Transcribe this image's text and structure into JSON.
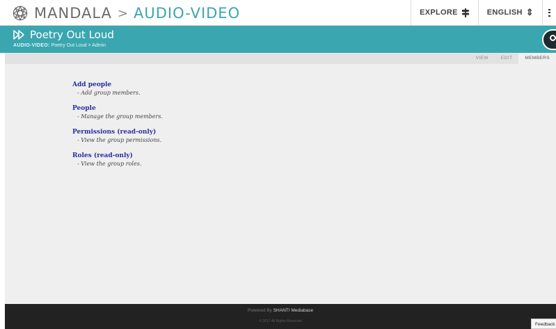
{
  "header": {
    "brand": "MANDALA",
    "separator": ">",
    "section": "AUDIO-VIDEO",
    "explore_label": "EXPLORE",
    "language_label": "ENGLISH",
    "language_caret": "↕",
    "logo_icon": "mandala-logo-icon",
    "explore_icon": "signpost-icon",
    "menu_icon": "hamburger-menu-icon"
  },
  "title_bar": {
    "title": "Poetry Out Loud",
    "title_icon": "audio-video-icon",
    "breadcrumb": {
      "root": "AUDIO-VIDEO:",
      "item1": "Poetry Out Loud",
      "sep": ">",
      "item2": "Admin"
    },
    "search_icon": "search-icon"
  },
  "tabs": [
    {
      "label": "VIEW",
      "active": false
    },
    {
      "label": "EDIT",
      "active": false
    },
    {
      "label": "MEMBERS",
      "active": true
    }
  ],
  "items": [
    {
      "link": "Add people",
      "desc": "- Add group members."
    },
    {
      "link": "People",
      "desc": "- Manage the group members."
    },
    {
      "link": "Permissions (read-only)",
      "desc": "- View the group permissions."
    },
    {
      "link": "Roles (read-only)",
      "desc": "- View the group roles."
    }
  ],
  "footer": {
    "powered_prefix": "Powered By",
    "powered_brand": "SHANTI Mediabase",
    "copyright": "© 2017 All Rights Reserved"
  },
  "feedback_label": "Feedback",
  "colors": {
    "accent": "#3aa6b0",
    "link": "#2a2f9c",
    "footer_bg": "#222222",
    "content_bg": "#efefef"
  }
}
